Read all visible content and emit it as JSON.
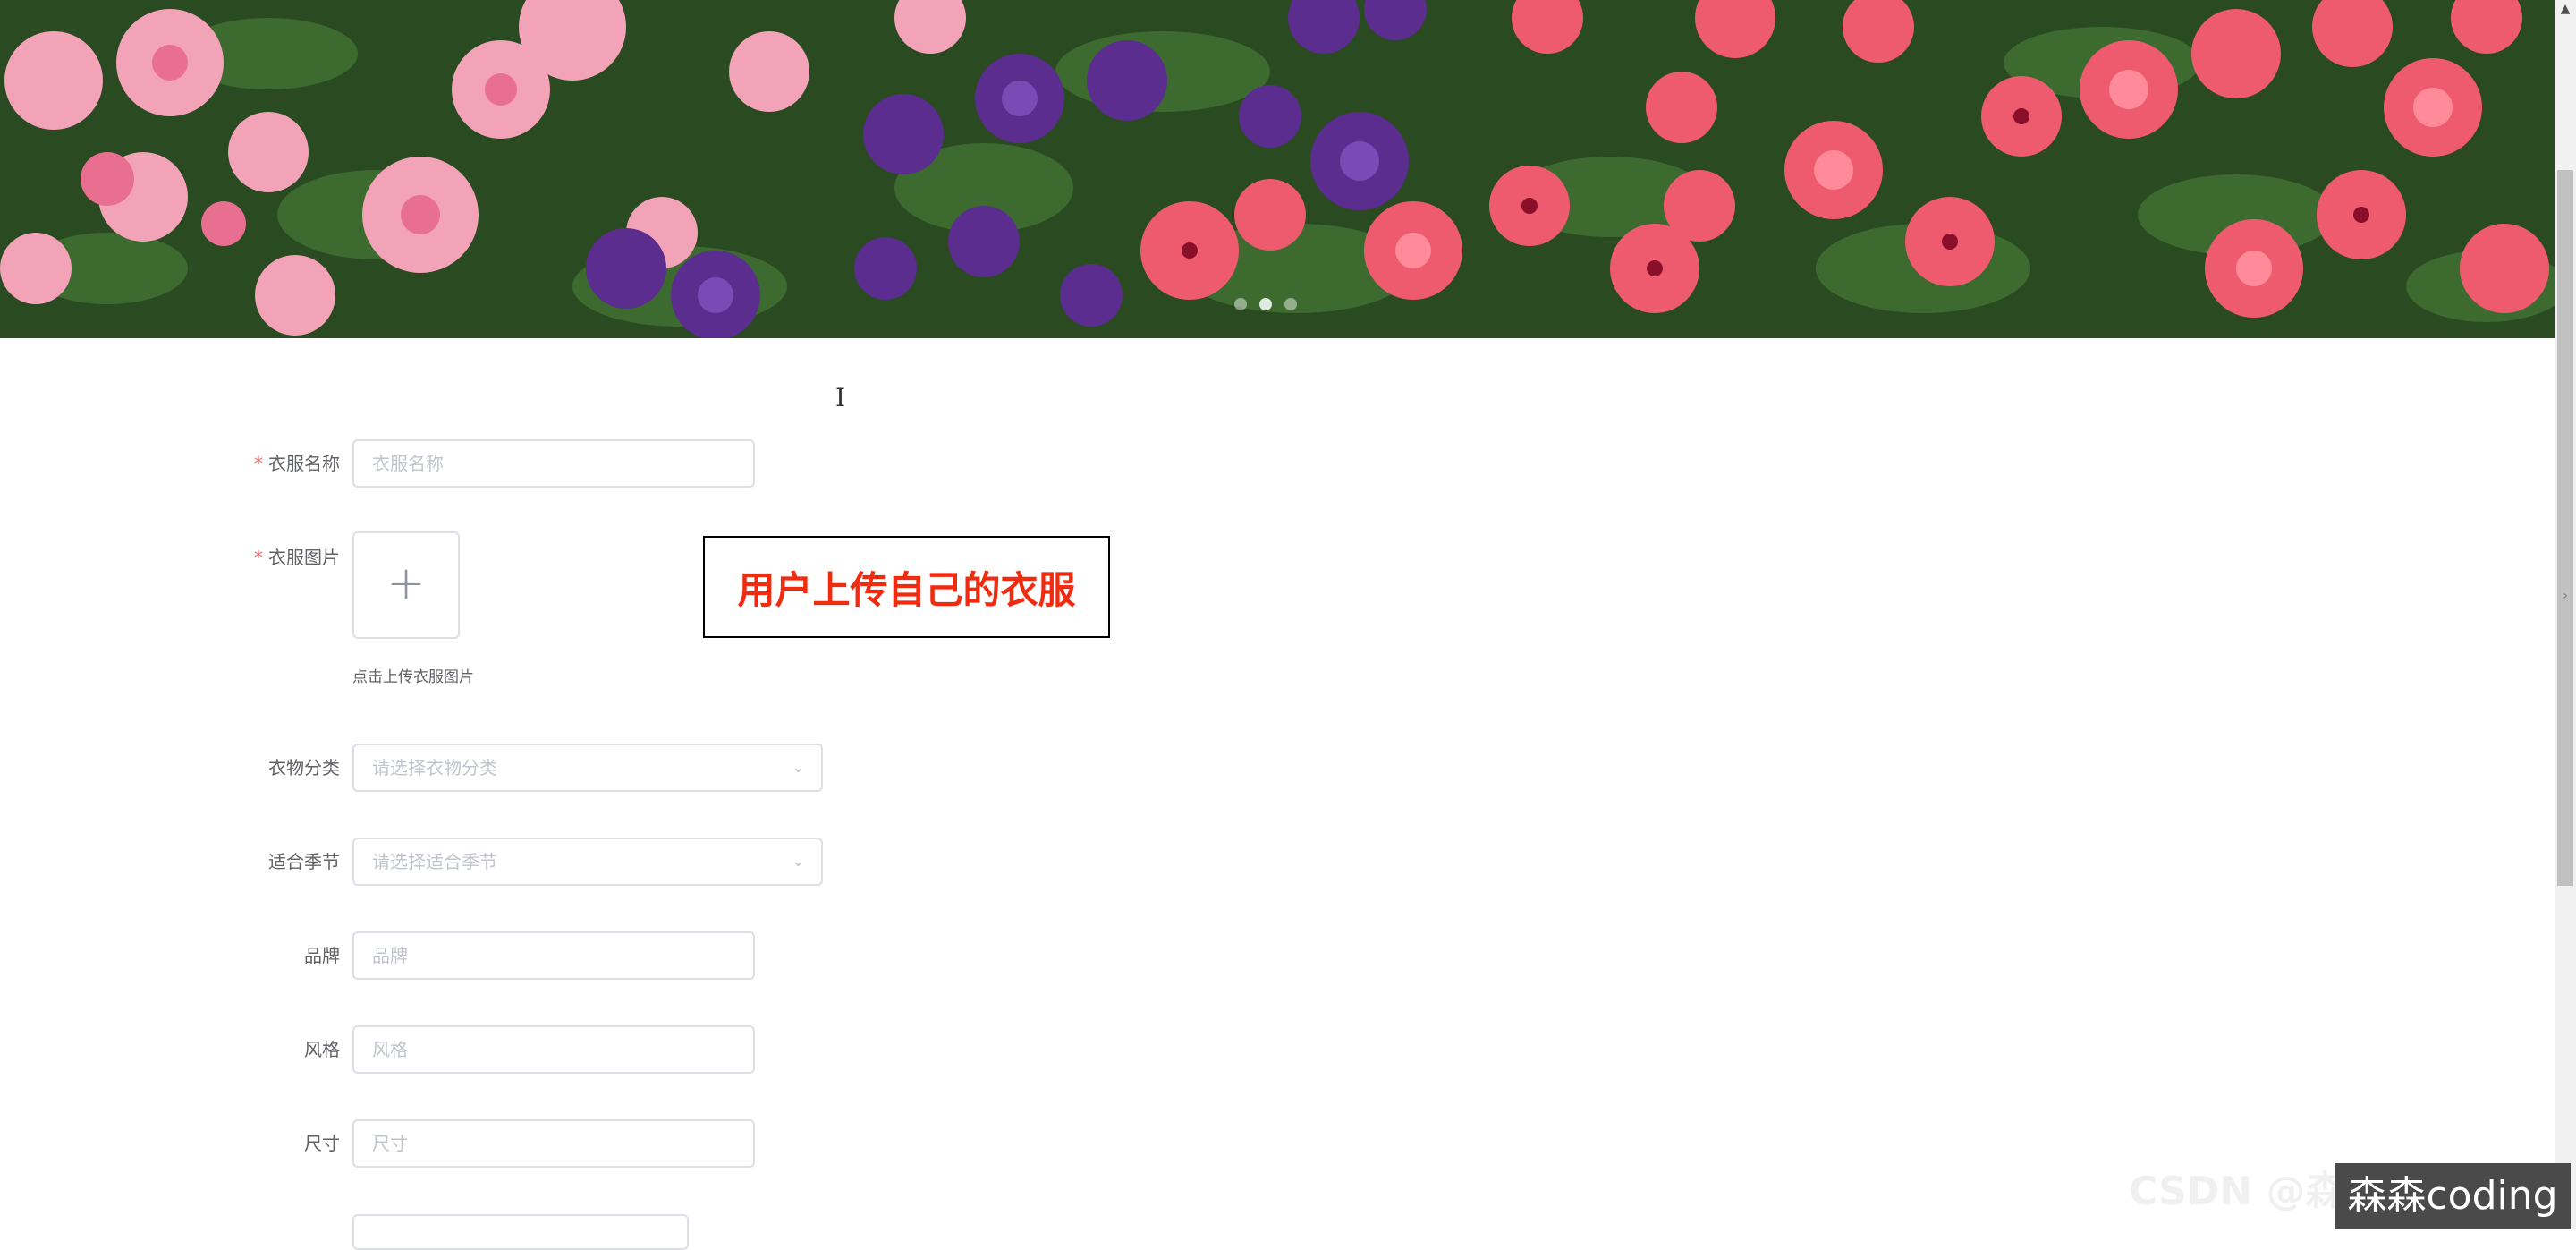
{
  "carousel": {
    "slide_count": 3,
    "active_index": 1
  },
  "form": {
    "clothing_name": {
      "label": "衣服名称",
      "required": true,
      "placeholder": "衣服名称",
      "value": ""
    },
    "clothing_image": {
      "label": "衣服图片",
      "required": true,
      "add_icon": "plus-icon",
      "tip": "点击上传衣服图片"
    },
    "category": {
      "label": "衣物分类",
      "placeholder": "请选择衣物分类",
      "value": ""
    },
    "season": {
      "label": "适合季节",
      "placeholder": "请选择适合季节",
      "value": ""
    },
    "brand": {
      "label": "品牌",
      "placeholder": "品牌",
      "value": ""
    },
    "style": {
      "label": "风格",
      "placeholder": "风格",
      "value": ""
    },
    "size": {
      "label": "尺寸",
      "placeholder": "尺寸",
      "value": ""
    }
  },
  "annotation": {
    "text": "用户上传自己的衣服",
    "color": "#ef2b10"
  },
  "watermark": {
    "text": "森森coding",
    "ghost_text": "CSDN @森森"
  },
  "colors": {
    "required_star": "#f56c6c",
    "border": "#dcdfe6",
    "placeholder": "#c0c4cc",
    "label": "#606266"
  }
}
